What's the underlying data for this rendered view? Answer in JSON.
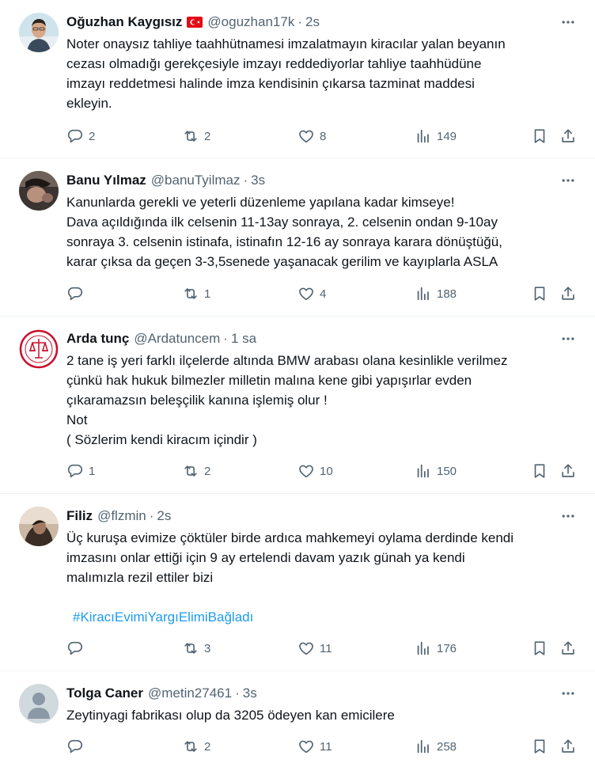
{
  "icons": {
    "reply": "reply-icon",
    "retweet": "retweet-icon",
    "like": "heart-icon",
    "views": "views-icon",
    "bookmark": "bookmark-icon",
    "share": "share-icon",
    "more": "more-icon"
  },
  "colors": {
    "text": "#0f1419",
    "muted": "#536471",
    "link": "#1d9bf0",
    "divider": "#eff3f4"
  },
  "tweets": [
    {
      "name": "Oğuzhan Kaygısız",
      "handle": "@oguzhan17k",
      "time": "2s",
      "lines": [
        "Noter onaysız tahliye taahhütnamesi imzalatmayın kiracılar yalan beyanın",
        "cezası olmadığı gerekçesiyle imzayı reddediyorlar tahliye taahhüdüne",
        "imzayı reddetmesi halinde imza kendisinin çıkarsa tazminat maddesi",
        "ekleyin."
      ],
      "replies": "2",
      "retweets": "2",
      "likes": "8",
      "views": "149"
    },
    {
      "name": "Banu Yılmaz",
      "handle": "@banuTyilmaz",
      "time": "3s",
      "lines": [
        "Kanunlarda gerekli ve yeterli düzenleme yapılana kadar kimseye!",
        "Dava açıldığında ilk celsenin 11-13ay sonraya, 2. celsenin ondan 9-10ay",
        "sonraya 3. celsenin istinafa, istinafın 12-16 ay sonraya karara dönüştüğü,",
        "karar çıksa da geçen 3-3,5senede yaşanacak gerilim ve kayıplarla ASLA"
      ],
      "replies": "",
      "retweets": "1",
      "likes": "4",
      "views": "188"
    },
    {
      "name": "Arda tunç",
      "handle": "@Ardatuncem",
      "time": "1 sa",
      "lines": [
        "2  tane iş yeri farklı ilçelerde altında BMW arabası olana kesinlikle verilmez",
        "çünkü hak hukuk bilmezler milletin malına kene gibi yapışırlar evden",
        "çıkaramazsın beleşçilik kanına işlemiş olur !",
        "Not",
        "( Sözlerim kendi kiracım içindir )"
      ],
      "replies": "1",
      "retweets": "2",
      "likes": "10",
      "views": "150"
    },
    {
      "name": "Filiz",
      "handle": "@flzmin",
      "time": "2s",
      "lines": [
        "Üç kuruşa evimize çöktüler birde ardıca mahkemeyi oylama derdinde kendi",
        "imzasını onlar ettiği için 9 ay ertelendi davam yazık günah ya kendi",
        "malımızla rezil ettiler bizi"
      ],
      "hashtag": "#KiracıEvimiYargıElimiBağladı",
      "replies": "",
      "retweets": "3",
      "likes": "11",
      "views": "176"
    },
    {
      "name": "Tolga Caner",
      "handle": "@metin27461",
      "time": "3s",
      "lines": [
        "Zeytinyagi fabrikası olup da 3205 ödeyen kan emicilere"
      ],
      "replies": "",
      "retweets": "2",
      "likes": "11",
      "views": "258"
    }
  ]
}
